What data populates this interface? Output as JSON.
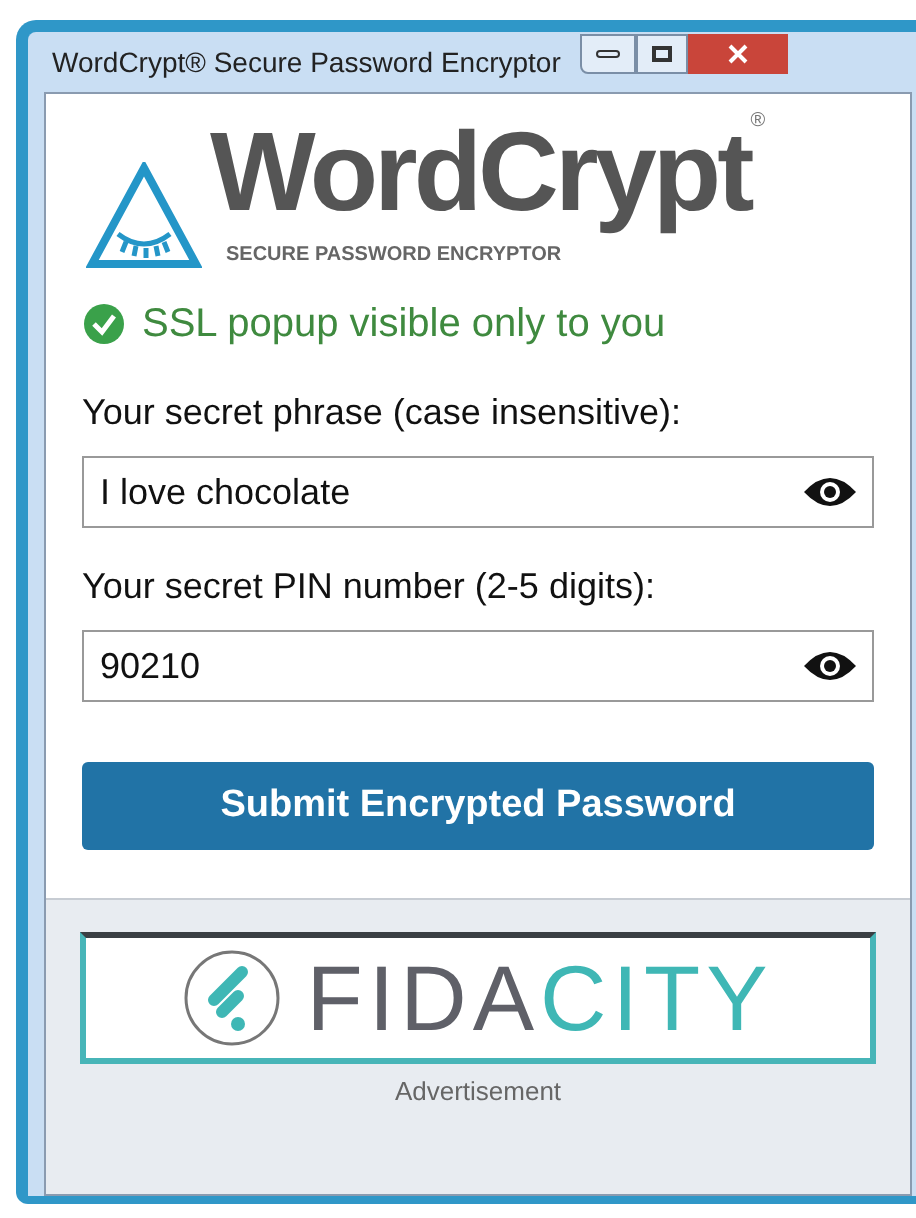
{
  "window": {
    "title": "WordCrypt® Secure Password Encryptor"
  },
  "logo": {
    "name": "WordCrypt",
    "registered": "®",
    "tagline": "SECURE PASSWORD ENCRYPTOR"
  },
  "notice": {
    "text": "SSL popup visible only to you"
  },
  "fields": [
    {
      "label": "Your secret phrase (case insensitive):",
      "value": "I love chocolate"
    },
    {
      "label": "Your secret PIN number (2-5 digits):",
      "value": "90210"
    }
  ],
  "submit": {
    "label": "Submit Encrypted Password"
  },
  "ad": {
    "brand": [
      {
        "text": "FIDA",
        "color": "#5f6068"
      },
      {
        "text": "CITY",
        "color": "#3fb7b5"
      }
    ],
    "caption": "Advertisement"
  }
}
